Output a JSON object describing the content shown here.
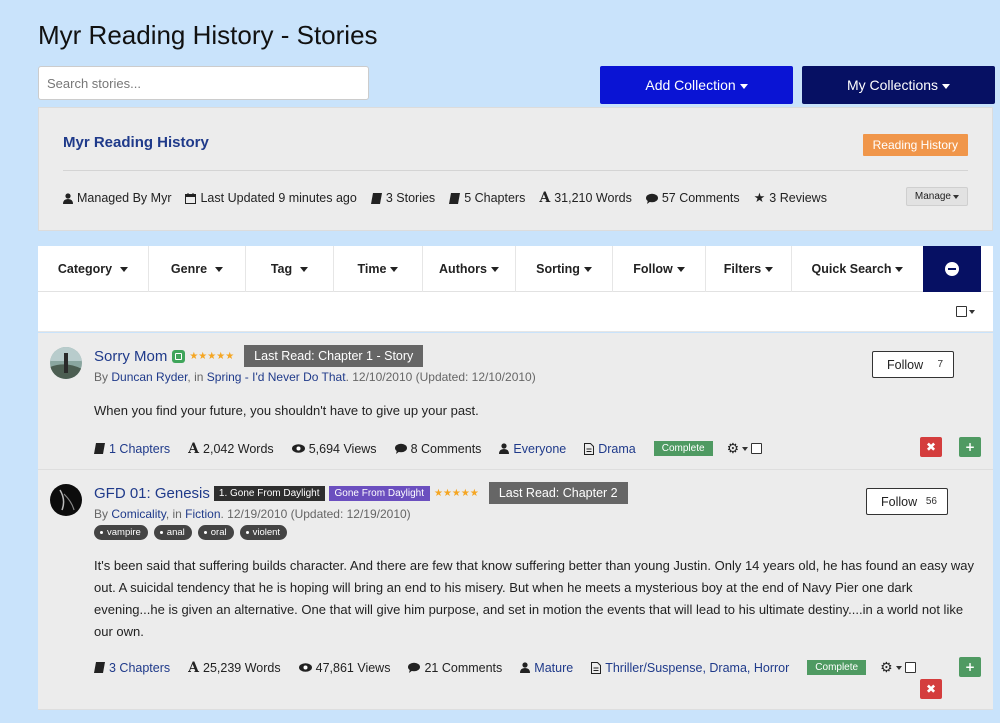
{
  "page": {
    "title": "Myr Reading History - Stories"
  },
  "search": {
    "placeholder": "Search stories..."
  },
  "buttons": {
    "add_collection": "Add Collection",
    "my_collections": "My Collections"
  },
  "collection": {
    "name": "Myr Reading History",
    "badge": "Reading History",
    "managed_by": "Managed By Myr",
    "last_updated": "Last Updated 9 minutes ago",
    "stories": "3 Stories",
    "chapters": "5 Chapters",
    "words": "31,210 Words",
    "comments": "57 Comments",
    "reviews": "3 Reviews",
    "manage": "Manage"
  },
  "filters": [
    "Category",
    "Genre",
    "Tag",
    "Time",
    "Authors",
    "Sorting",
    "Follow",
    "Filters",
    "Quick Search"
  ],
  "stories": [
    {
      "title": "Sorry Mom",
      "stars": "★★★★★",
      "last_read": "Last Read: Chapter 1 - Story",
      "by": "By",
      "author": "Duncan Ryder",
      "in_text": ", in",
      "series": "Spring - I'd Never Do That",
      "dates": ". 12/10/2010 (Updated: 12/10/2010)",
      "summary": "When you find your future, you shouldn't have to give up your past.",
      "chapters": "1 Chapters",
      "words": "2,042 Words",
      "views": "5,694 Views",
      "comments": "8 Comments",
      "rating": "Everyone",
      "genres": "Drama",
      "status": "Complete",
      "follow_label": "Follow",
      "follow_count": "7"
    },
    {
      "title": "GFD 01: Genesis",
      "series_tag": "1. Gone From Daylight",
      "series_badge": "Gone From Daylight",
      "stars": "★★★★★",
      "last_read": "Last Read: Chapter 2",
      "by": "By",
      "author": "Comicality",
      "in_text": ", in",
      "series": "Fiction",
      "dates": ". 12/19/2010 (Updated: 12/19/2010)",
      "tags": [
        "vampire",
        "anal",
        "oral",
        "violent"
      ],
      "summary": "It's been said that suffering builds character. And there are few that know suffering better than young Justin. Only 14 years old, he has found an easy way out. A suicidal tendency that he is hoping will bring an end to his misery. But when he meets a mysterious boy at the end of Navy Pier one dark evening...he is given an alternative. One that will give him purpose, and set in motion the events that will lead to his ultimate destiny....in a world not like our own.",
      "chapters": "3 Chapters",
      "words": "25,239 Words",
      "views": "47,861 Views",
      "comments": "21 Comments",
      "rating": "Mature",
      "genres": "Thriller/Suspense, Drama, Horror",
      "status": "Complete",
      "follow_label": "Follow",
      "follow_count": "56"
    }
  ],
  "actions": {
    "remove": "✖",
    "add": "+"
  },
  "colors": {
    "primary": "#0a14d4",
    "dark_navy": "#061063",
    "orange": "#f0964a",
    "complete_green": "#4f9a62",
    "remove_red": "#d43d3d",
    "link_blue": "#1f3a8a",
    "page_bg": "#c9e3fb"
  },
  "icons": [
    "user-icon",
    "calendar-icon",
    "book-icon",
    "font-icon",
    "comment-icon",
    "star-icon",
    "eye-icon",
    "file-icon",
    "gear-icon",
    "approved-icon"
  ]
}
